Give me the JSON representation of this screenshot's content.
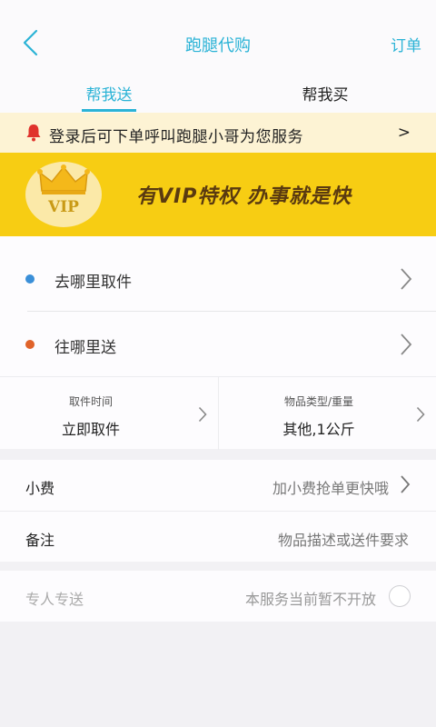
{
  "header": {
    "title": "跑腿代购",
    "orders_label": "订单",
    "accent_color": "#2bb3d6"
  },
  "tabs": [
    {
      "label": "帮我送",
      "active": true
    },
    {
      "label": "帮我买",
      "active": false
    }
  ],
  "notice": {
    "icon": "bell-icon",
    "text": "登录后可下单呼叫跑腿小哥为您服务",
    "arrow": ">"
  },
  "vip_banner": {
    "badge_text": "VIP",
    "slogan": "有VIP特权  办事就是快",
    "background_color": "#f7cd13"
  },
  "address": {
    "pickup": {
      "label": "去哪里取件",
      "dot_color": "#3a8fd8"
    },
    "deliver": {
      "label": "往哪里送",
      "dot_color": "#e0632a"
    }
  },
  "info": {
    "pickup_time": {
      "caption": "取件时间",
      "value": "立即取件"
    },
    "item_type": {
      "caption": "物品类型/重量",
      "value": "其他,1公斤"
    }
  },
  "extras": {
    "tip": {
      "label": "小费",
      "hint": "加小费抢单更快哦"
    },
    "remark": {
      "label": "备注",
      "placeholder": "物品描述或送件要求"
    }
  },
  "exclusive": {
    "label": "专人专送",
    "status": "本服务当前暂不开放",
    "enabled": false
  }
}
